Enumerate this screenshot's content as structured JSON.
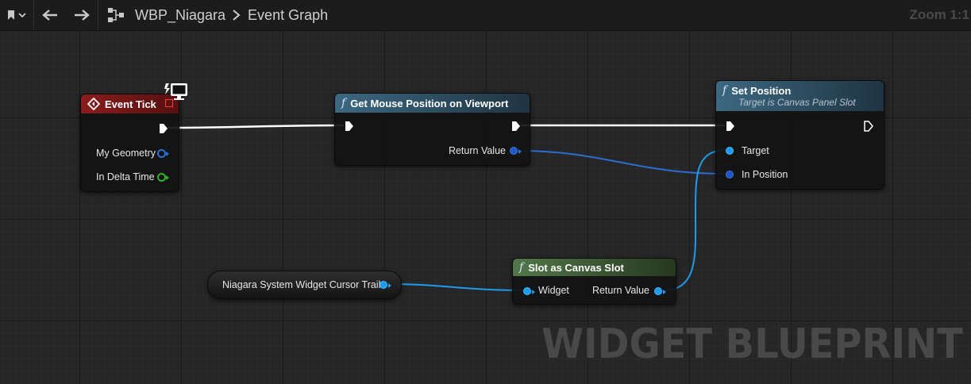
{
  "toolbar": {
    "breadcrumb_asset": "WBP_Niagara",
    "breadcrumb_graph": "Event Graph",
    "zoom": "Zoom 1:1"
  },
  "nodes": {
    "event_tick": {
      "title": "Event Tick",
      "pins": [
        "My Geometry",
        "In Delta Time"
      ],
      "color": "#7a1515"
    },
    "get_mouse": {
      "title": "Get Mouse Position on Viewport",
      "outputs": [
        "Return Value"
      ],
      "color": "#35596e"
    },
    "set_position": {
      "title": "Set Position",
      "subtitle": "Target is Canvas Panel Slot",
      "inputs": [
        "Target",
        "In Position"
      ],
      "color": "#35596e"
    },
    "slot_canvas": {
      "title": "Slot as Canvas Slot",
      "input": "Widget",
      "output": "Return Value",
      "color": "#476a40"
    },
    "variable": {
      "label": "Niagara System Widget Cursor Trail"
    }
  },
  "watermark": "WIDGET BLUEPRINT",
  "colors": {
    "exec_wire": "#ffffff",
    "object_pin": "#1e9bea",
    "struct_pin": "#2a6fd4",
    "float_pin": "#2fb32f"
  }
}
